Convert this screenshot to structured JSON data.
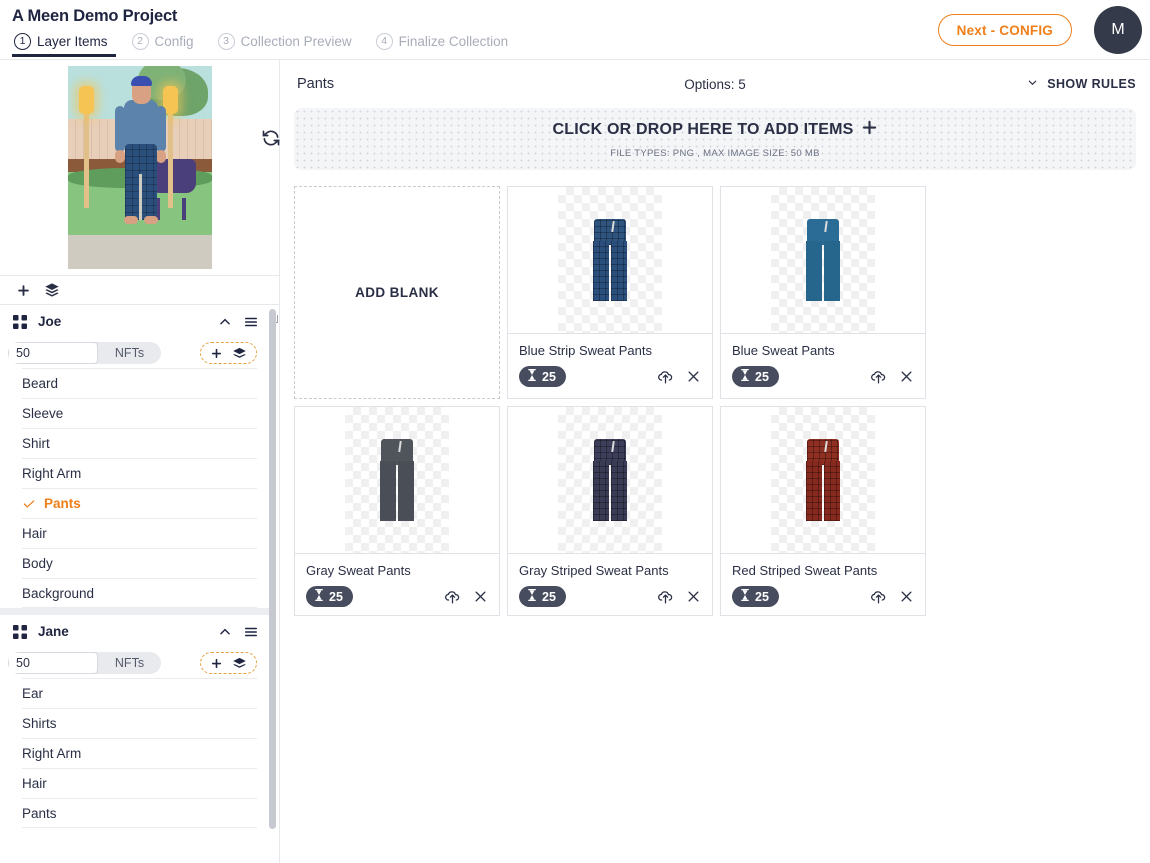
{
  "header": {
    "project_title": "A Meen Demo Project",
    "next_button": "Next - CONFIG",
    "avatar_initial": "M",
    "tabs": [
      {
        "num": "1",
        "label": "Layer Items",
        "active": true
      },
      {
        "num": "2",
        "label": "Config",
        "active": false
      },
      {
        "num": "3",
        "label": "Collection Preview",
        "active": false
      },
      {
        "num": "4",
        "label": "Finalize Collection",
        "active": false
      }
    ]
  },
  "sidebar": {
    "refresh_icon": "refresh-icon",
    "toolbar": {
      "add_icon": "plus-icon",
      "layers_icon": "layers-stack-icon"
    },
    "groups": [
      {
        "name": "Joe",
        "nft_count": "50",
        "nft_unit": "NFTs",
        "items": [
          {
            "label": "Beard",
            "selected": false
          },
          {
            "label": "Sleeve",
            "selected": false
          },
          {
            "label": "Shirt",
            "selected": false
          },
          {
            "label": "Right Arm",
            "selected": false
          },
          {
            "label": "Pants",
            "selected": true
          },
          {
            "label": "Hair",
            "selected": false
          },
          {
            "label": "Body",
            "selected": false
          },
          {
            "label": "Background",
            "selected": false
          }
        ]
      },
      {
        "name": "Jane",
        "nft_count": "50",
        "nft_unit": "NFTs",
        "items": [
          {
            "label": "Ear",
            "selected": false
          },
          {
            "label": "Shirts",
            "selected": false
          },
          {
            "label": "Right Arm",
            "selected": false
          },
          {
            "label": "Hair",
            "selected": false
          },
          {
            "label": "Pants",
            "selected": false
          }
        ]
      }
    ]
  },
  "main": {
    "title": "Pants",
    "options_count": "Options: 5",
    "show_rules": "SHOW RULES",
    "dropzone": {
      "primary": "CLICK OR DROP HERE TO ADD ITEMS",
      "secondary": "FILE TYPES: PNG , MAX IMAGE SIZE: 50 MB"
    },
    "add_blank_label": "ADD BLANK",
    "cards": [
      {
        "title": "Blue Strip Sweat Pants",
        "rarity": "25",
        "waist": "#2f5480",
        "leg": "#2a4f7c",
        "pattern": true
      },
      {
        "title": "Blue Sweat Pants",
        "rarity": "25",
        "waist": "#2a6c95",
        "leg": "#26658c",
        "pattern": false
      },
      {
        "title": "Gray Sweat Pants",
        "rarity": "25",
        "waist": "#50555c",
        "leg": "#4a4f57",
        "pattern": false
      },
      {
        "title": "Gray Striped Sweat Pants",
        "rarity": "25",
        "waist": "#3d3f5a",
        "leg": "#3a3c55",
        "pattern": true
      },
      {
        "title": "Red Striped Sweat Pants",
        "rarity": "25",
        "waist": "#8e2f22",
        "leg": "#86291e",
        "pattern": true
      }
    ]
  },
  "colors": {
    "accent": "#ef7f1a",
    "dark": "#1f2440",
    "badge": "#474d5e",
    "dashed_orange": "#e2a23d"
  }
}
